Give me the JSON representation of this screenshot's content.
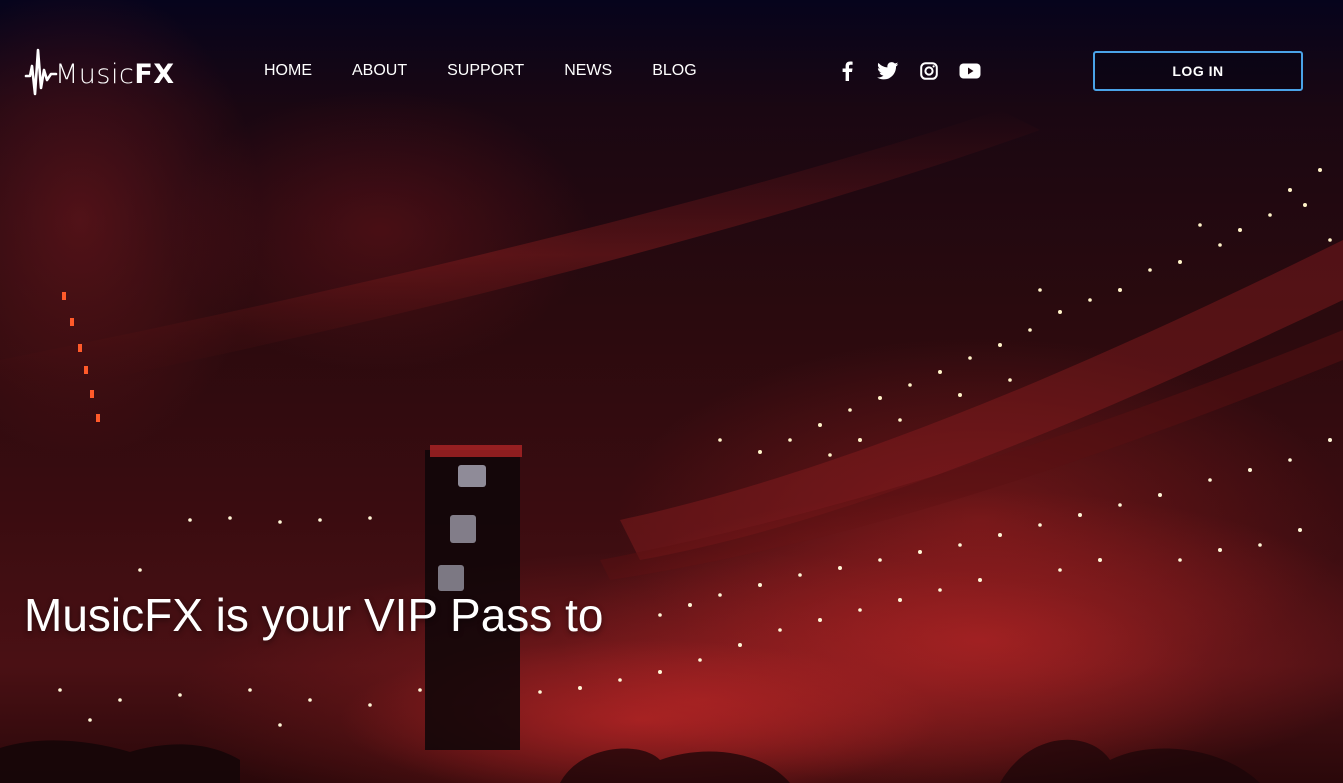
{
  "brand": {
    "name_light": "Music",
    "name_bold": "FX",
    "logo_icon": "sound-wave-icon"
  },
  "nav": {
    "items": [
      {
        "label": "HOME"
      },
      {
        "label": "ABOUT"
      },
      {
        "label": "SUPPORT"
      },
      {
        "label": "NEWS"
      },
      {
        "label": "BLOG"
      }
    ]
  },
  "social": {
    "icons": [
      "facebook-icon",
      "twitter-icon",
      "instagram-icon",
      "youtube-icon"
    ]
  },
  "auth": {
    "login_label": "LOG IN"
  },
  "hero": {
    "headline": "MusicFX is your VIP Pass to"
  },
  "colors": {
    "accent": "#4aa3e8",
    "text": "#ffffff",
    "top_band": "#06041c",
    "stage_red": "#c02020"
  }
}
